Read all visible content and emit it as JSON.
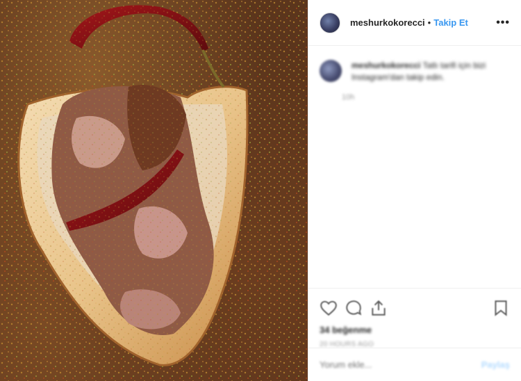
{
  "post": {
    "photo_alt": "Kokoreç sandviçi ve kurutulmuş kırmızı biber"
  },
  "header": {
    "username": "meshurkokorecci",
    "separator": "•",
    "follow_label": "Takip Et",
    "more_label": "•••"
  },
  "caption": {
    "username": "meshurkokorecci",
    "text": "Tatlı tarifi için bizi Instagram'dan takip edin.",
    "time": "10h"
  },
  "actions": {
    "likes": "34 beğenme",
    "date": "20 HOURS AGO"
  },
  "comment": {
    "placeholder": "Yorum ekle...",
    "post_label": "Paylaş"
  },
  "colors": {
    "accent": "#3897f0",
    "border": "#efefef",
    "muted": "#999999"
  }
}
